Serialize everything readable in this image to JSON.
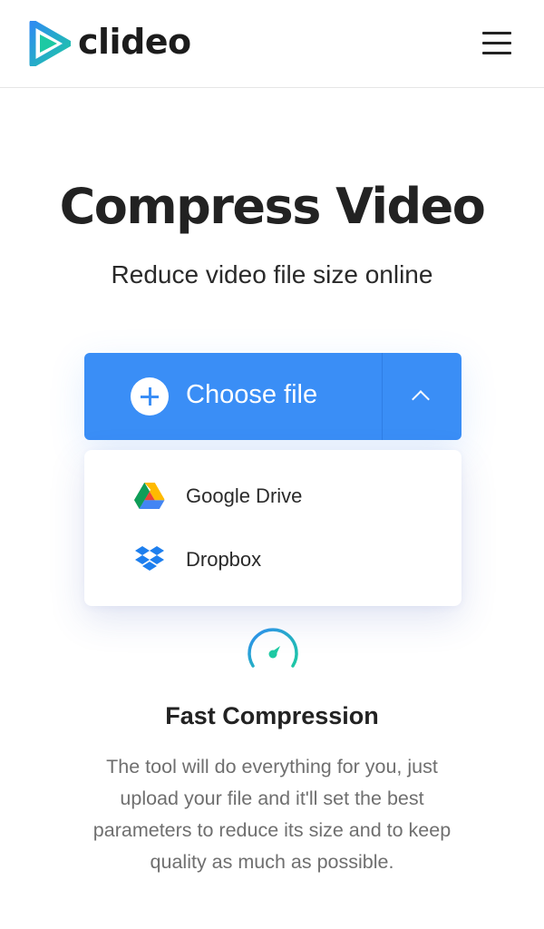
{
  "header": {
    "logo_text": "clideo",
    "logo_colors": {
      "blue": "#2f8cf0",
      "green": "#1dc9a3"
    },
    "menu_icon": "hamburger-menu-icon"
  },
  "hero": {
    "title": "Compress Video",
    "subtitle": "Reduce video file size online"
  },
  "upload": {
    "choose_label": "Choose file",
    "accent": "#3a8ef6",
    "toggle_icon": "chevron-up-icon",
    "sources": [
      {
        "label": "Google Drive",
        "icon": "google-drive-icon"
      },
      {
        "label": "Dropbox",
        "icon": "dropbox-icon"
      }
    ]
  },
  "feature": {
    "icon": "speedometer-icon",
    "title": "Fast Compression",
    "description": "The tool will do everything for you, just upload your file and it'll set the best parameters to reduce its size and to keep quality as much as possible."
  }
}
